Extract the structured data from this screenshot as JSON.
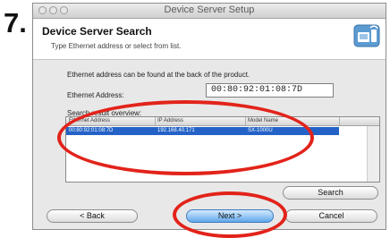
{
  "step_number": "7.",
  "window": {
    "title": "Device Server Setup"
  },
  "header": {
    "title": "Device Server Search",
    "subtitle": "Type Ethernet address or select from list.",
    "icon": "network-device-icon"
  },
  "main": {
    "info_text": "Ethernet address can be found at the back of the product.",
    "ethernet_label": "Ethernet Address:",
    "ethernet_value": "00:80:92:01:08:7D",
    "overview_label": "Search result overview:",
    "table": {
      "columns": [
        "Ethernet Address",
        "IP Address",
        "Model Name"
      ],
      "rows": [
        [
          "00:80:92:01:08:7D",
          "192.168.40.171",
          "SX-1000U"
        ]
      ]
    }
  },
  "buttons": {
    "search": "Search",
    "back": "< Back",
    "next": "Next >",
    "cancel": "Cancel"
  },
  "colors": {
    "highlight_circle": "#e2231a",
    "selection": "#2462c7",
    "default_button": "#5fa7ea"
  }
}
